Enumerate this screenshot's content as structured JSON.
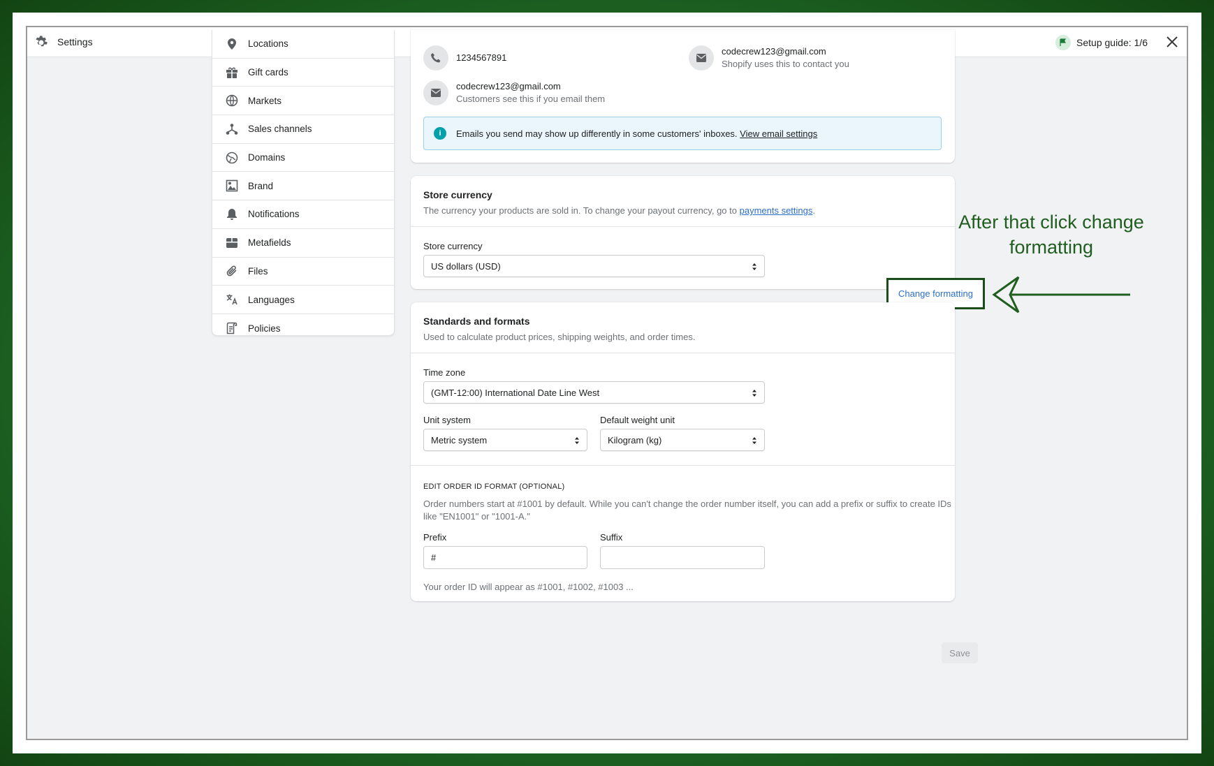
{
  "topbar": {
    "title": "Settings",
    "setup_guide": "Setup guide: 1/6"
  },
  "sidebar": {
    "items": [
      {
        "label": "Locations",
        "icon": "location-pin-icon"
      },
      {
        "label": "Gift cards",
        "icon": "gift-icon"
      },
      {
        "label": "Markets",
        "icon": "globe-markets-icon"
      },
      {
        "label": "Sales channels",
        "icon": "channels-icon"
      },
      {
        "label": "Domains",
        "icon": "globe-icon"
      },
      {
        "label": "Brand",
        "icon": "brand-icon"
      },
      {
        "label": "Notifications",
        "icon": "bell-icon"
      },
      {
        "label": "Metafields",
        "icon": "metafields-icon"
      },
      {
        "label": "Files",
        "icon": "paperclip-icon"
      },
      {
        "label": "Languages",
        "icon": "translate-icon"
      },
      {
        "label": "Policies",
        "icon": "policy-icon"
      }
    ]
  },
  "contact": {
    "phone": "1234567891",
    "store_email": "codecrew123@gmail.com",
    "store_email_note": "Shopify uses this to contact you",
    "sender_email": "codecrew123@gmail.com",
    "sender_email_note": "Customers see this if you email them",
    "banner_text": "Emails you send may show up differently in some customers' inboxes.",
    "banner_link": "View email settings"
  },
  "currency": {
    "title": "Store currency",
    "desc_prefix": "The currency your products are sold in. To change your payout currency, go to",
    "desc_link": "payments settings",
    "desc_suffix": ".",
    "field_label": "Store currency",
    "selected": "US dollars (USD)",
    "change_link": "Change formatting"
  },
  "standards": {
    "title": "Standards and formats",
    "desc": "Used to calculate product prices, shipping weights, and order times.",
    "timezone_label": "Time zone",
    "timezone_value": "(GMT-12:00) International Date Line West",
    "unit_label": "Unit system",
    "unit_value": "Metric system",
    "weight_label": "Default weight unit",
    "weight_value": "Kilogram (kg)",
    "order_heading": "EDIT ORDER ID FORMAT (OPTIONAL)",
    "order_desc_1": "Order numbers start at #1001 by default. While you can't change the order number itself, you can add a prefix or suffix to create IDs",
    "order_desc_2": "like \"EN1001\" or \"1001-A.\"",
    "prefix_label": "Prefix",
    "prefix_value": "#",
    "suffix_label": "Suffix",
    "suffix_value": "",
    "preview": "Your order ID will appear as #1001, #1002, #1003 ..."
  },
  "footer": {
    "save_label": "Save"
  },
  "annotation": {
    "line1": "After that click change",
    "line2": "formatting"
  },
  "colors": {
    "frame": "#1f5e1f",
    "link": "#2c6ecb",
    "banner_bg": "#eaf6fb",
    "annotation": "#1f5e1f"
  }
}
